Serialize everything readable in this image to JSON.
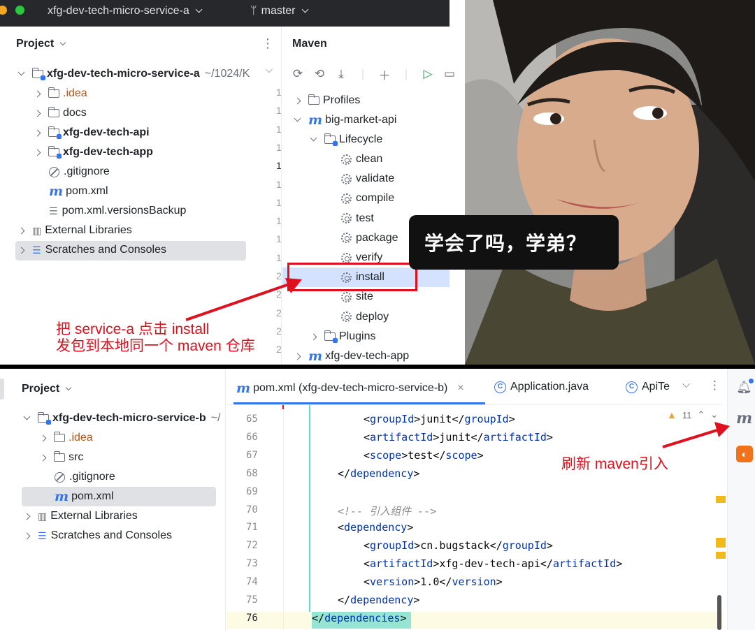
{
  "top_window": {
    "title_project": "xfg-dev-tech-micro-service-a",
    "branch": "master",
    "project_panel_title": "Project",
    "project_tree": [
      {
        "label": "xfg-dev-tech-micro-service-a",
        "path": "~/1024/K",
        "type": "module",
        "expanded": true
      },
      {
        "label": ".idea",
        "type": "folder"
      },
      {
        "label": "docs",
        "type": "folder"
      },
      {
        "label": "xfg-dev-tech-api",
        "type": "module"
      },
      {
        "label": "xfg-dev-tech-app",
        "type": "module"
      },
      {
        "label": ".gitignore",
        "type": "ignore"
      },
      {
        "label": "pom.xml",
        "type": "maven"
      },
      {
        "label": "pom.xml.versionsBackup",
        "type": "text"
      },
      {
        "label": "External Libraries",
        "type": "library"
      },
      {
        "label": "Scratches and Consoles",
        "type": "scratches"
      }
    ],
    "maven_panel_title": "Maven",
    "gutter_numbers": [
      "1",
      "1",
      "1",
      "1",
      "1",
      "1",
      "1",
      "1",
      "1",
      "1",
      "2",
      "2",
      "2",
      "2",
      "2"
    ],
    "maven_tree": {
      "profiles": "Profiles",
      "project": "big-market-api",
      "lifecycle": "Lifecycle",
      "phases": [
        "clean",
        "validate",
        "compile",
        "test",
        "package",
        "verify",
        "install",
        "site",
        "deploy"
      ],
      "plugins": "Plugins",
      "next_project": "xfg-dev-tech-app"
    },
    "annotation_line1": "把 service-a 点击 install",
    "annotation_line2": "发包到本地同一个 maven 仓库",
    "speech_bubble": "学会了吗，学弟？"
  },
  "bottom_window": {
    "project_panel_title": "Project",
    "project_tree": [
      {
        "label": "xfg-dev-tech-micro-service-b",
        "path": "~/",
        "type": "module"
      },
      {
        "label": ".idea",
        "type": "folder"
      },
      {
        "label": "src",
        "type": "folder"
      },
      {
        "label": ".gitignore",
        "type": "ignore"
      },
      {
        "label": "pom.xml",
        "type": "maven"
      },
      {
        "label": "External Libraries",
        "type": "library"
      },
      {
        "label": "Scratches and Consoles",
        "type": "scratches"
      }
    ],
    "tabs": [
      {
        "label": "pom.xml (xfg-dev-tech-micro-service-b)",
        "icon": "maven-icon",
        "active": true
      },
      {
        "label": "Application.java",
        "icon": "class-icon"
      },
      {
        "label": "ApiTe",
        "icon": "class-icon"
      }
    ],
    "warning_count": "11",
    "code_lines": [
      {
        "num": "65",
        "indent": 2,
        "tag": "groupId",
        "value": "junit"
      },
      {
        "num": "66",
        "indent": 2,
        "tag": "artifactId",
        "value": "junit"
      },
      {
        "num": "67",
        "indent": 2,
        "tag": "scope",
        "value": "test"
      },
      {
        "num": "68",
        "indent": 1,
        "close": "dependency"
      },
      {
        "num": "69"
      },
      {
        "num": "70",
        "indent": 1,
        "comment": "<!-- 引入组件 -->"
      },
      {
        "num": "71",
        "indent": 1,
        "open": "dependency"
      },
      {
        "num": "72",
        "indent": 2,
        "tag": "groupId",
        "value": "cn.bugstack"
      },
      {
        "num": "73",
        "indent": 2,
        "tag": "artifactId",
        "value": "xfg-dev-tech-api"
      },
      {
        "num": "74",
        "indent": 2,
        "tag": "version",
        "value": "1.0"
      },
      {
        "num": "75",
        "indent": 1,
        "close": "dependency"
      },
      {
        "num": "76",
        "indent": 0,
        "close": "dependencies"
      }
    ],
    "annotation": "刷新 maven引入",
    "colors": {
      "accent": "#3574f0",
      "annotation": "#e0101e",
      "warning": "#f2b91a"
    }
  }
}
